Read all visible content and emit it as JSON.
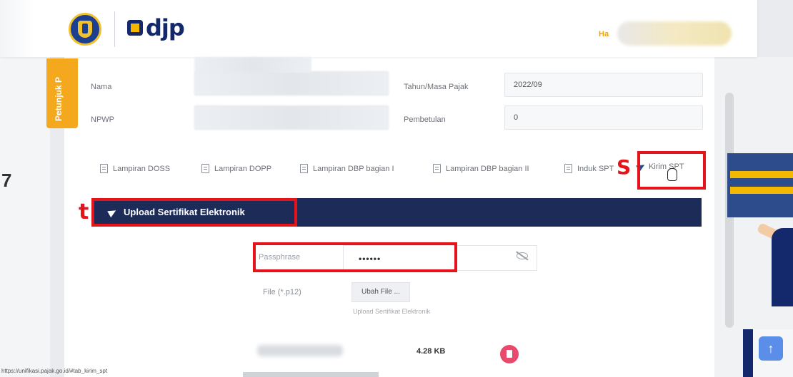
{
  "header": {
    "brand_text": "djp",
    "greeting": "Ha"
  },
  "side_tab": {
    "label": "Petunjuk P"
  },
  "form": {
    "nama_label": "Nama",
    "npwp_label": "NPWP",
    "tahun_label": "Tahun/Masa Pajak",
    "tahun_value": "2022/09",
    "pembetulan_label": "Pembetulan",
    "pembetulan_value": "0"
  },
  "tabs": [
    {
      "label": "Lampiran DOSS"
    },
    {
      "label": "Lampiran DOPP"
    },
    {
      "label": "Lampiran DBP bagian I"
    },
    {
      "label": "Lampiran DBP bagian II"
    },
    {
      "label": "Induk SPT"
    },
    {
      "label": "Kirim SPT"
    }
  ],
  "annotations": {
    "s": "S",
    "t": "t"
  },
  "upload": {
    "title": "Upload Sertifikat Elektronik",
    "passphrase_label": "Passphrase",
    "passphrase_value": "••••••",
    "file_label": "File (*.p12)",
    "file_button": "Ubah File ...",
    "hint": "Upload Sertifikat Elektronik",
    "file_size": "4.28 KB"
  },
  "status_url": "https://unifikasi.pajak.go.id/#tab_kirim_spt",
  "colors": {
    "primary": "#1c2b57",
    "accent": "#f4a81d",
    "annotation": "#e5141b",
    "delete": "#e84a6e"
  }
}
